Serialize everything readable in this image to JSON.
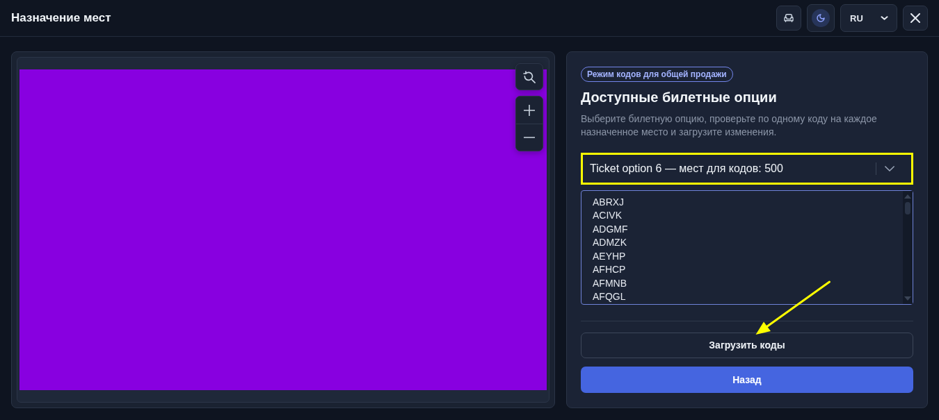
{
  "header": {
    "title": "Назначение мест",
    "theme_dark": true,
    "language": "RU"
  },
  "panel": {
    "badge": "Режим кодов для общей продажи",
    "title": "Доступные билетные опции",
    "description": "Выберите билетную опцию, проверьте по одному коду на каждое назначенное место и загрузите изменения.",
    "ticket_select": {
      "value": "Ticket option 6 — мест для кодов: 500",
      "highlighted": true
    },
    "codes_field": {
      "focused": true,
      "items": [
        "ABRXJ",
        "ACIVK",
        "ADGMF",
        "ADMZK",
        "AEYHP",
        "AFHCP",
        "AFMNB",
        "AFQGL"
      ]
    },
    "buttons": [
      {
        "label": "Загрузить коды",
        "kind": "outline"
      },
      {
        "label": "Назад",
        "kind": "primary"
      }
    ]
  },
  "annotations": [
    {
      "kind": "arrow"
    }
  ]
}
